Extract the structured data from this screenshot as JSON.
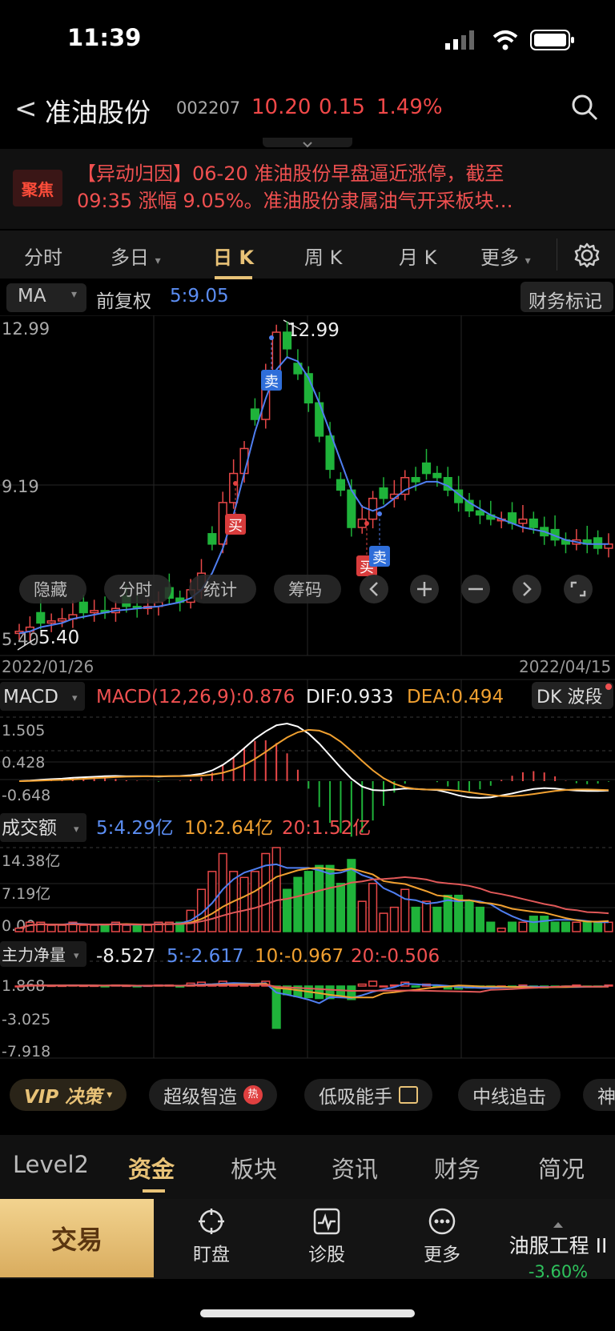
{
  "status": {
    "time": "11:39"
  },
  "header": {
    "back_label": "<",
    "stock_name": "准油股份",
    "stock_code": "002207",
    "price": "10.20",
    "change": "0.15",
    "change_pct": "1.49%",
    "up_color": "#f04848"
  },
  "news": {
    "badge": "聚焦",
    "line1": "【异动归因】06-20 准油股份早盘逼近涨停，截至",
    "line2": "09:35 涨幅 9.05%。准油股份隶属油气开采板块…"
  },
  "ktabs": [
    {
      "label": "分时",
      "active": false
    },
    {
      "label": "多日",
      "active": false,
      "dropdown": true
    },
    {
      "label": "日 K",
      "active": true
    },
    {
      "label": "周 K",
      "active": false
    },
    {
      "label": "月 K",
      "active": false
    },
    {
      "label": "更多",
      "active": false,
      "dropdown": true
    }
  ],
  "ma_row": {
    "indicator": "MA",
    "adjust": "前复权",
    "ma5": "5:9.05",
    "finance_mark": "财务标记"
  },
  "price_chart": {
    "y_max_label": "12.99",
    "y_mid_label": "9.19",
    "y_min_label": "5.40",
    "high_marker": "12.99",
    "low_marker": "5.40",
    "start_date": "2022/01/26",
    "end_date": "2022/04/15",
    "buy_label": "买",
    "sell_label": "卖",
    "overlay_buttons": [
      "隐藏",
      "分时",
      "统计",
      "筹码"
    ]
  },
  "macd": {
    "name": "MACD",
    "value": "MACD(12,26,9):0.876",
    "dif": "DIF:0.933",
    "dea": "DEA:0.494",
    "button": "DK 波段",
    "y_labels": [
      "1.505",
      "0.428",
      "-0.648"
    ]
  },
  "volume": {
    "name": "成交额",
    "ma5": "5:4.29亿",
    "ma10": "10:2.64亿",
    "ma20": "20:1.52亿",
    "y_labels": [
      "14.38亿",
      "7.19亿",
      "0.00"
    ]
  },
  "mainflow": {
    "name": "主力净量",
    "value": "-8.527",
    "ma5": "5:-2.617",
    "ma10": "10:-0.967",
    "ma20": "20:-0.506",
    "y_labels": [
      "1.868",
      "-3.025",
      "-7.918"
    ]
  },
  "chart_data": {
    "type": "bar",
    "title": "",
    "candles_close": [
      5.5,
      5.6,
      5.7,
      5.75,
      5.8,
      5.9,
      5.95,
      6.0,
      5.95,
      6.05,
      6.1,
      6.05,
      6.1,
      6.2,
      6.3,
      6.2,
      6.5,
      6.9,
      7.6,
      8.6,
      9.3,
      9.9,
      10.6,
      11.6,
      12.7,
      12.3,
      11.7,
      11.0,
      10.2,
      9.4,
      8.9,
      8.0,
      8.2,
      8.7,
      8.7,
      8.8,
      9.2,
      9.1,
      9.3,
      9.2,
      8.9,
      8.6,
      8.4,
      8.3,
      8.2,
      8.2,
      8.1,
      8.2,
      8.0,
      7.8,
      7.7,
      7.6,
      7.7,
      7.6,
      7.5,
      7.6
    ],
    "ma5": [
      5.45,
      5.5,
      5.6,
      5.65,
      5.7,
      5.8,
      5.85,
      5.9,
      5.95,
      6.0,
      6.02,
      6.05,
      6.08,
      6.1,
      6.15,
      6.2,
      6.3,
      6.5,
      6.9,
      7.5,
      8.3,
      9.3,
      10.3,
      11.1,
      11.8,
      12.1,
      12.0,
      11.6,
      11.0,
      10.3,
      9.6,
      8.9,
      8.5,
      8.4,
      8.5,
      8.7,
      8.9,
      9.0,
      9.1,
      9.1,
      9.0,
      8.8,
      8.6,
      8.45,
      8.3,
      8.2,
      8.1,
      8.0,
      7.95,
      7.9,
      7.8,
      7.7,
      7.65,
      7.6,
      7.6,
      7.6
    ],
    "ylim": [
      5.4,
      12.99
    ],
    "grid": true
  }
}
